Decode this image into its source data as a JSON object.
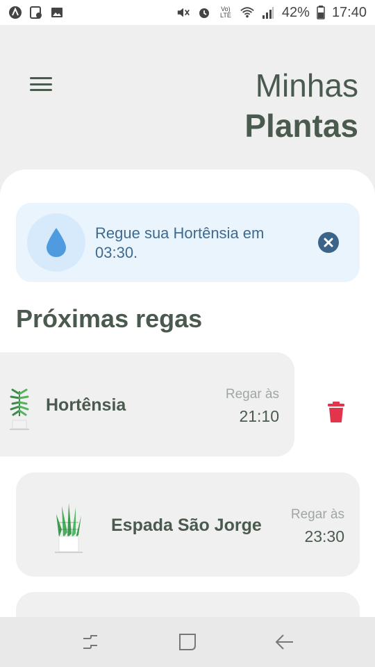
{
  "status_bar": {
    "left_icons": [
      "app-icon",
      "calendar-icon",
      "image-icon"
    ],
    "right_icons": [
      "mute-icon",
      "alarm-icon",
      "volte-icon",
      "wifi-icon",
      "signal-icon"
    ],
    "volte_label": "Vo) LTE",
    "battery_percent": "42%",
    "time": "17:40"
  },
  "header": {
    "title_line1": "Minhas",
    "title_line2": "Plantas"
  },
  "alert": {
    "message": "Regue sua Hortênsia em 03:30.",
    "icon": "water-drop-icon",
    "close_icon": "close-circle-icon"
  },
  "section_title": "Próximas regas",
  "plants": [
    {
      "name": "Hortênsia",
      "water_label": "Regar às",
      "water_time": "21:10",
      "icon": "hydrangea-plant-icon"
    },
    {
      "name": "Espada São Jorge",
      "water_label": "Regar às",
      "water_time": "23:30",
      "icon": "snake-plant-icon"
    }
  ],
  "delete_icon": "trash-icon",
  "nav": [
    "recent-apps-icon",
    "home-icon",
    "back-icon"
  ],
  "colors": {
    "primary_text": "#4a5a4e",
    "alert_bg": "#eaf4fd",
    "alert_text": "#3d6a8e",
    "delete": "#e2344b"
  }
}
